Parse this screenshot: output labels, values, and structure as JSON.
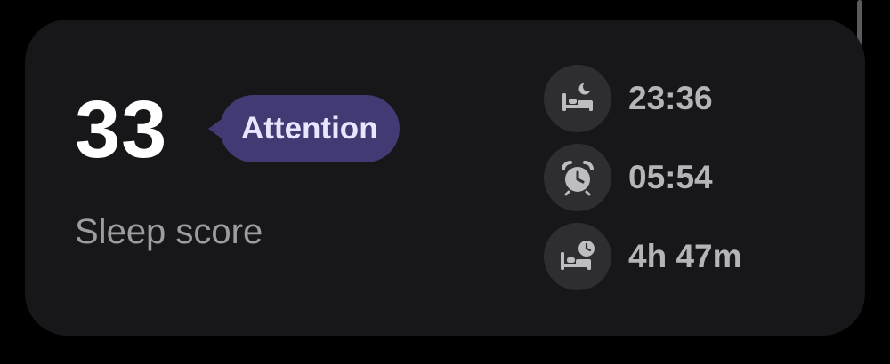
{
  "sleep_card": {
    "score": "33",
    "status_badge": "Attention",
    "score_label": "Sleep score",
    "stats": [
      {
        "icon": "bed-moon-icon",
        "value": "23:36"
      },
      {
        "icon": "alarm-clock-icon",
        "value": "05:54"
      },
      {
        "icon": "bed-clock-icon",
        "value": "4h 47m"
      }
    ]
  },
  "colors": {
    "background": "#000000",
    "card": "#17171a",
    "badge": "#423a72",
    "badge_text": "#e8e6ff",
    "icon_circle": "#2e2e32",
    "icon_glyph": "#bdbdc2"
  }
}
